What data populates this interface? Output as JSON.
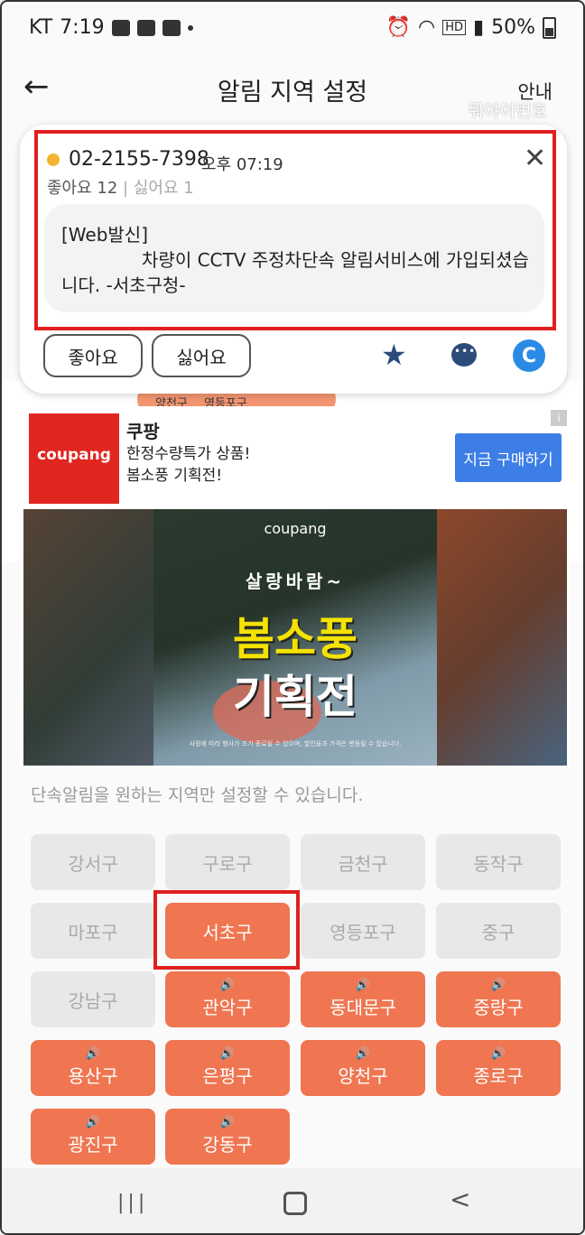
{
  "status_bar": {
    "carrier": "KT",
    "time": "7:19",
    "battery": "50%"
  },
  "header": {
    "title": "알림 지역 설정",
    "guide": "안내",
    "watermark": "뭐야이번호"
  },
  "map_labels": [
    "양천구",
    "영등포구"
  ],
  "popup": {
    "phone": "02-2155-7398",
    "time": "오후 07:19",
    "likes_text": "좋아요 12",
    "dislikes_text": "싫어요 1",
    "separator": "|",
    "message": "[Web발신]\n              차량이 CCTV 주정차단속 알림서비스에 가입되셨습니다. -서초구청-",
    "like_button": "좋아요",
    "dislike_button": "싫어요",
    "close_glyph": "✕",
    "c_badge": "C"
  },
  "ad": {
    "badge_text": "coupang",
    "title": "쿠팡",
    "line1": "한정수량특가 상품!",
    "line2": "봄소풍 기획전!",
    "button": "지금 구매하기",
    "info": "i",
    "banner_brand": "coupang",
    "banner_headline": "살랑바람~",
    "banner_main1": "봄소풍",
    "banner_main2": "기획전",
    "banner_fine": "사정에 따라 행사가 조기 종료될 수 있으며, 할인율과 가격은 변동될 수 있습니다."
  },
  "regions": {
    "hint": "단속알림을 원하는 지역만 설정할 수 있습니다.",
    "speaker": "🔊",
    "items": [
      {
        "label": "강서구",
        "active": false
      },
      {
        "label": "구로구",
        "active": false
      },
      {
        "label": "금천구",
        "active": false
      },
      {
        "label": "동작구",
        "active": false
      },
      {
        "label": "마포구",
        "active": false
      },
      {
        "label": "서초구",
        "active": true
      },
      {
        "label": "영등포구",
        "active": false
      },
      {
        "label": "중구",
        "active": false
      },
      {
        "label": "강남구",
        "active": false
      },
      {
        "label": "관악구",
        "active": true
      },
      {
        "label": "동대문구",
        "active": true
      },
      {
        "label": "중랑구",
        "active": true
      },
      {
        "label": "용산구",
        "active": true
      },
      {
        "label": "은평구",
        "active": true
      },
      {
        "label": "양천구",
        "active": true
      },
      {
        "label": "종로구",
        "active": true
      },
      {
        "label": "광진구",
        "active": true
      },
      {
        "label": "강동구",
        "active": true
      }
    ]
  },
  "colors": {
    "active": "#ef7651",
    "inactive": "#e8e8e8",
    "highlight": "#e01f1f",
    "ad_button": "#3d7ee6"
  },
  "navbar": {
    "recent": "|||",
    "back": "<"
  }
}
